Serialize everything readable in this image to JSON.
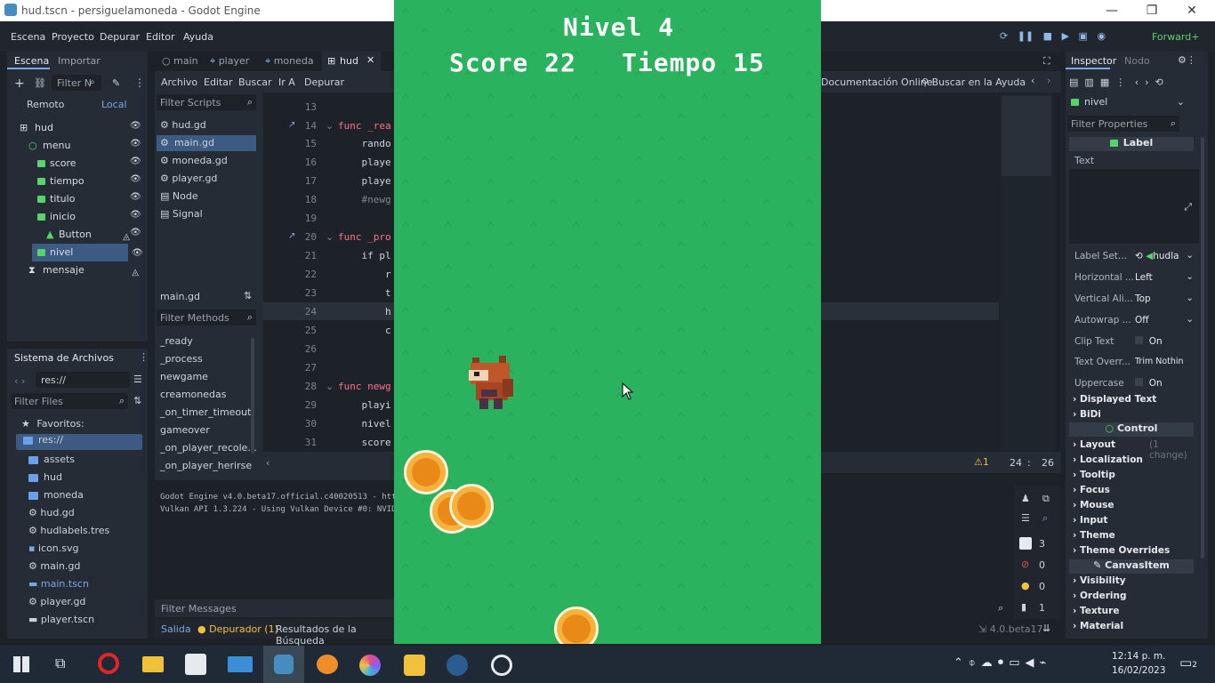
{
  "window": {
    "title": "hud.tscn - persiguelamoneda - Godot Engine"
  },
  "menubar": {
    "items": [
      "Escena",
      "Proyecto",
      "Depurar",
      "Editor",
      "Ayuda"
    ],
    "renderer": "Forward+"
  },
  "scene_dock": {
    "tabs": [
      "Escena",
      "Importar"
    ],
    "filter_placeholder": "Filter N",
    "modes": [
      "Remoto",
      "Local"
    ],
    "nodes": [
      {
        "name": "hud",
        "depth": 0
      },
      {
        "name": "menu",
        "depth": 1
      },
      {
        "name": "score",
        "depth": 2
      },
      {
        "name": "tiempo",
        "depth": 2
      },
      {
        "name": "titulo",
        "depth": 2
      },
      {
        "name": "inicio",
        "depth": 2
      },
      {
        "name": "Button",
        "depth": 3
      },
      {
        "name": "nivel",
        "depth": 2
      },
      {
        "name": "mensaje",
        "depth": 1
      }
    ]
  },
  "filesystem": {
    "title": "Sistema de Archivos",
    "path": "res://",
    "filter_placeholder": "Filter Files",
    "favorites": "Favoritos:",
    "items": [
      "res://",
      "assets",
      "hud",
      "moneda",
      "hud.gd",
      "hudlabels.tres",
      "icon.svg",
      "main.gd",
      "main.tscn",
      "player.gd",
      "player.tscn"
    ]
  },
  "editor_tabs": [
    "main",
    "player",
    "moneda",
    "hud"
  ],
  "script_menu": [
    "Archivo",
    "Editar",
    "Buscar",
    "Ir A",
    "Depurar"
  ],
  "help_links": [
    "Documentación Online",
    "Buscar en la Ayuda"
  ],
  "scripts": {
    "filter_placeholder": "Filter Scripts",
    "items": [
      "hud.gd",
      "main.gd",
      "moneda.gd",
      "player.gd",
      "Node",
      "Signal"
    ],
    "current": "main.gd",
    "methods_placeholder": "Filter Methods",
    "methods": [
      "_ready",
      "_process",
      "newgame",
      "creamonedas",
      "_on_timer_timeout",
      "gameover",
      "_on_player_recole...",
      "_on_player_herirse"
    ]
  },
  "code": {
    "lines": [
      {
        "n": "13",
        "t": ""
      },
      {
        "n": "14",
        "t": "func _rea"
      },
      {
        "n": "15",
        "t": "    rando"
      },
      {
        "n": "16",
        "t": "    playe"
      },
      {
        "n": "17",
        "t": "    playe"
      },
      {
        "n": "18",
        "t": "    #newg"
      },
      {
        "n": "19",
        "t": ""
      },
      {
        "n": "20",
        "t": "func _pro"
      },
      {
        "n": "21",
        "t": "    if pl"
      },
      {
        "n": "22",
        "t": "        r"
      },
      {
        "n": "23",
        "t": "        t"
      },
      {
        "n": "24",
        "t": "        h"
      },
      {
        "n": "25",
        "t": "        c"
      },
      {
        "n": "26",
        "t": ""
      },
      {
        "n": "27",
        "t": ""
      },
      {
        "n": "28",
        "t": "func newg"
      },
      {
        "n": "29",
        "t": "    playi"
      },
      {
        "n": "30",
        "t": "    nivel"
      },
      {
        "n": "31",
        "t": "    score"
      }
    ],
    "warnings": "1",
    "cursor_line": "24",
    "cursor_col": "26"
  },
  "output": {
    "lines": [
      "Godot Engine v4.0.beta17.official.c40020513 - htt",
      "Vulkan API 1.3.224 - Using Vulkan Device #0: NVID"
    ],
    "filter_placeholder": "Filter Messages",
    "counts": [
      "3",
      "0",
      "0",
      "1"
    ],
    "bottom_tabs": [
      "Salida",
      "Depurador (1)",
      "Resultados de la Búsqueda"
    ],
    "version": "4.0.beta17"
  },
  "inspector": {
    "tabs": [
      "Inspector",
      "Nodo"
    ],
    "node": "nivel",
    "filter_placeholder": "Filter Properties",
    "class_label": "Label",
    "text_label": "Text",
    "props": [
      {
        "label": "Label Set...",
        "value": "hudla"
      },
      {
        "label": "Horizontal ...",
        "value": "Left"
      },
      {
        "label": "Vertical Ali...",
        "value": "Top"
      },
      {
        "label": "Autowrap ...",
        "value": "Off"
      },
      {
        "label": "Clip Text",
        "value": "On"
      },
      {
        "label": "Text Overr...",
        "value": "Trim Nothin"
      },
      {
        "label": "Uppercase",
        "value": "On"
      }
    ],
    "sections_a": [
      "Displayed Text",
      "BiDi"
    ],
    "control_label": "Control",
    "sections_b": [
      "Layout",
      "Localization",
      "Tooltip",
      "Focus",
      "Mouse",
      "Input",
      "Theme",
      "Theme Overrides"
    ],
    "layout_note": "(1 change)",
    "canvasitem_label": "CanvasItem",
    "sections_c": [
      "Visibility",
      "Ordering",
      "Texture",
      "Material"
    ]
  },
  "game": {
    "level_text": "Nivel 4",
    "score_text": "Score 22",
    "time_text": "Tiempo 15"
  },
  "taskbar": {
    "time": "12:14 p. m.",
    "date": "16/02/2023",
    "notifications": "2"
  }
}
